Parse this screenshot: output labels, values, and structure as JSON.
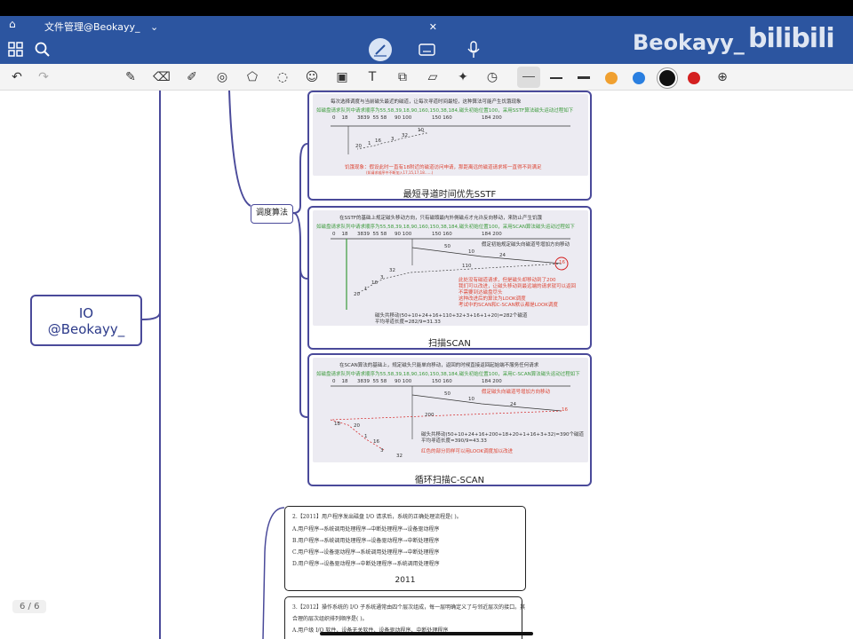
{
  "app": {
    "tab_title": "文件管理@Beokayy_",
    "tab_dropdown": "⌄",
    "tab_close": "✕",
    "watermark": "Beokayy_"
  },
  "toolbar": {
    "tools": [
      "pen",
      "eraser",
      "highlighter",
      "lasso",
      "shapes",
      "select",
      "sticker",
      "image",
      "text",
      "camera",
      "ruler",
      "laser",
      "timer"
    ],
    "colors": [
      "#f0a030",
      "#2a7fe0",
      "#111111",
      "#d42020"
    ],
    "active_color": "#111111"
  },
  "page_indicator": "6 / 6",
  "mindmap": {
    "root": {
      "line1": "IO",
      "line2": "@Beokayy_"
    },
    "branch_label": "调度算法",
    "cards": [
      {
        "caption": "最短寻道时间优先SSTF",
        "header": "每次选择调度与当前磁头最近的磁道，让每次寻道时间最短，这种算法可能产生饥饿现象",
        "request": "如磁盘请求队列中请求顺序为55,58,39,18,90,160,150,38,184,磁头初始位置100，采用SSTF算法磁头运动过程如下",
        "ticks": [
          "0",
          "18",
          "3839",
          "55 58",
          "90 100",
          "150 160",
          "184 200"
        ],
        "note": "饥饿现象：假设此时一直有18附近的磁道访问申请，那距离远的磁道请求将一直得不到满足",
        "subnote": "(如请求顺序中不断加入17,15,17,18……)",
        "dists": [
          "10",
          "32",
          "3",
          "16",
          "1",
          "20"
        ]
      },
      {
        "caption": "扫描SCAN",
        "header": "在SSTF的基础上规定磁头移动方向，只有磁頭最内外側磁点才允许反向移动，来防止产生饥饿",
        "request": "如磁盘请求队列中请求顺序为55,58,39,18,90,160,150,38,184,磁头初始位置100，采用SCAN算法磁头运动过程如下",
        "ticks": [
          "0",
          "18",
          "3839",
          "55 58",
          "90 100",
          "150 160",
          "184 200"
        ],
        "direction": "假定初始规定磁头向磁道号增加方向移动",
        "notes": [
          "此处没有磁道请求，但是磁头却移动到了200",
          "我们可以改进，让磁头移动到最远端的请求就可以返回",
          "不需要到达磁盘尽头",
          "这种改进后的算法为LOOK调度",
          "考试中的SCAN和C-SCAN默认都是LOOK调度"
        ],
        "sum": "磁头共移动(50+10+24+16+110+32+3+16+1+20)=282个磁道",
        "avg": "平均寻道长度=282/9=31.33",
        "dists": [
          "50",
          "10",
          "24",
          "16",
          "110",
          "32",
          "3",
          "16",
          "1",
          "20"
        ]
      },
      {
        "caption": "循环扫描C-SCAN",
        "header": "在SCAN算法的基础上，规定磁头只能单向移动，返回的时候直接返回起始端不服务任何请求",
        "request": "如磁盘请求队列中请求顺序为55,58,39,18,90,160,150,38,184,磁头初始位置100，采用C-SCAN算法磁头运动过程如下",
        "ticks": [
          "0",
          "18",
          "3839",
          "55 58",
          "90 100",
          "150 160",
          "184 200"
        ],
        "direction": "假定磁头向磁道号增加方向移动",
        "sum": "磁头共移动(50+10+24+16+200+18+20+1+16+3+32)=390个磁道",
        "avg": "平均寻道长度=390/9=43.33",
        "note": "红色的部分同样可以用LOOK调度加以改进",
        "dists": [
          "50",
          "10",
          "24",
          "16",
          "200",
          "18",
          "20",
          "1",
          "16",
          "3",
          "32"
        ]
      }
    ],
    "questions": [
      {
        "caption": "2011",
        "stem": "2.【2011】用户程序发出磁盘 I/O 请求后，系统的正确处理流程是(  )。",
        "options": [
          "A.用户程序→系统调用处理程序→中断处理程序→设备驱动程序",
          "B.用户程序→系统调用处理程序→设备驱动程序→中断处理程序",
          "C.用户程序→设备驱动程序→系统调用处理程序→中断处理程序",
          "D.用户程序→设备驱动程序→中断处理程序→系统调用处理程序"
        ]
      },
      {
        "caption": "",
        "stem": "3.【2012】操作系统的 I/O 子系统通常由四个层次组成，每一层明确定义了与邻近层次的接口。其",
        "stem2": "合理的层次组织排列顺序是(  )。",
        "options": [
          "A.用户级 I/O 软件、设备无关软件、设备驱动程序、中断处理程序"
        ]
      }
    ]
  }
}
